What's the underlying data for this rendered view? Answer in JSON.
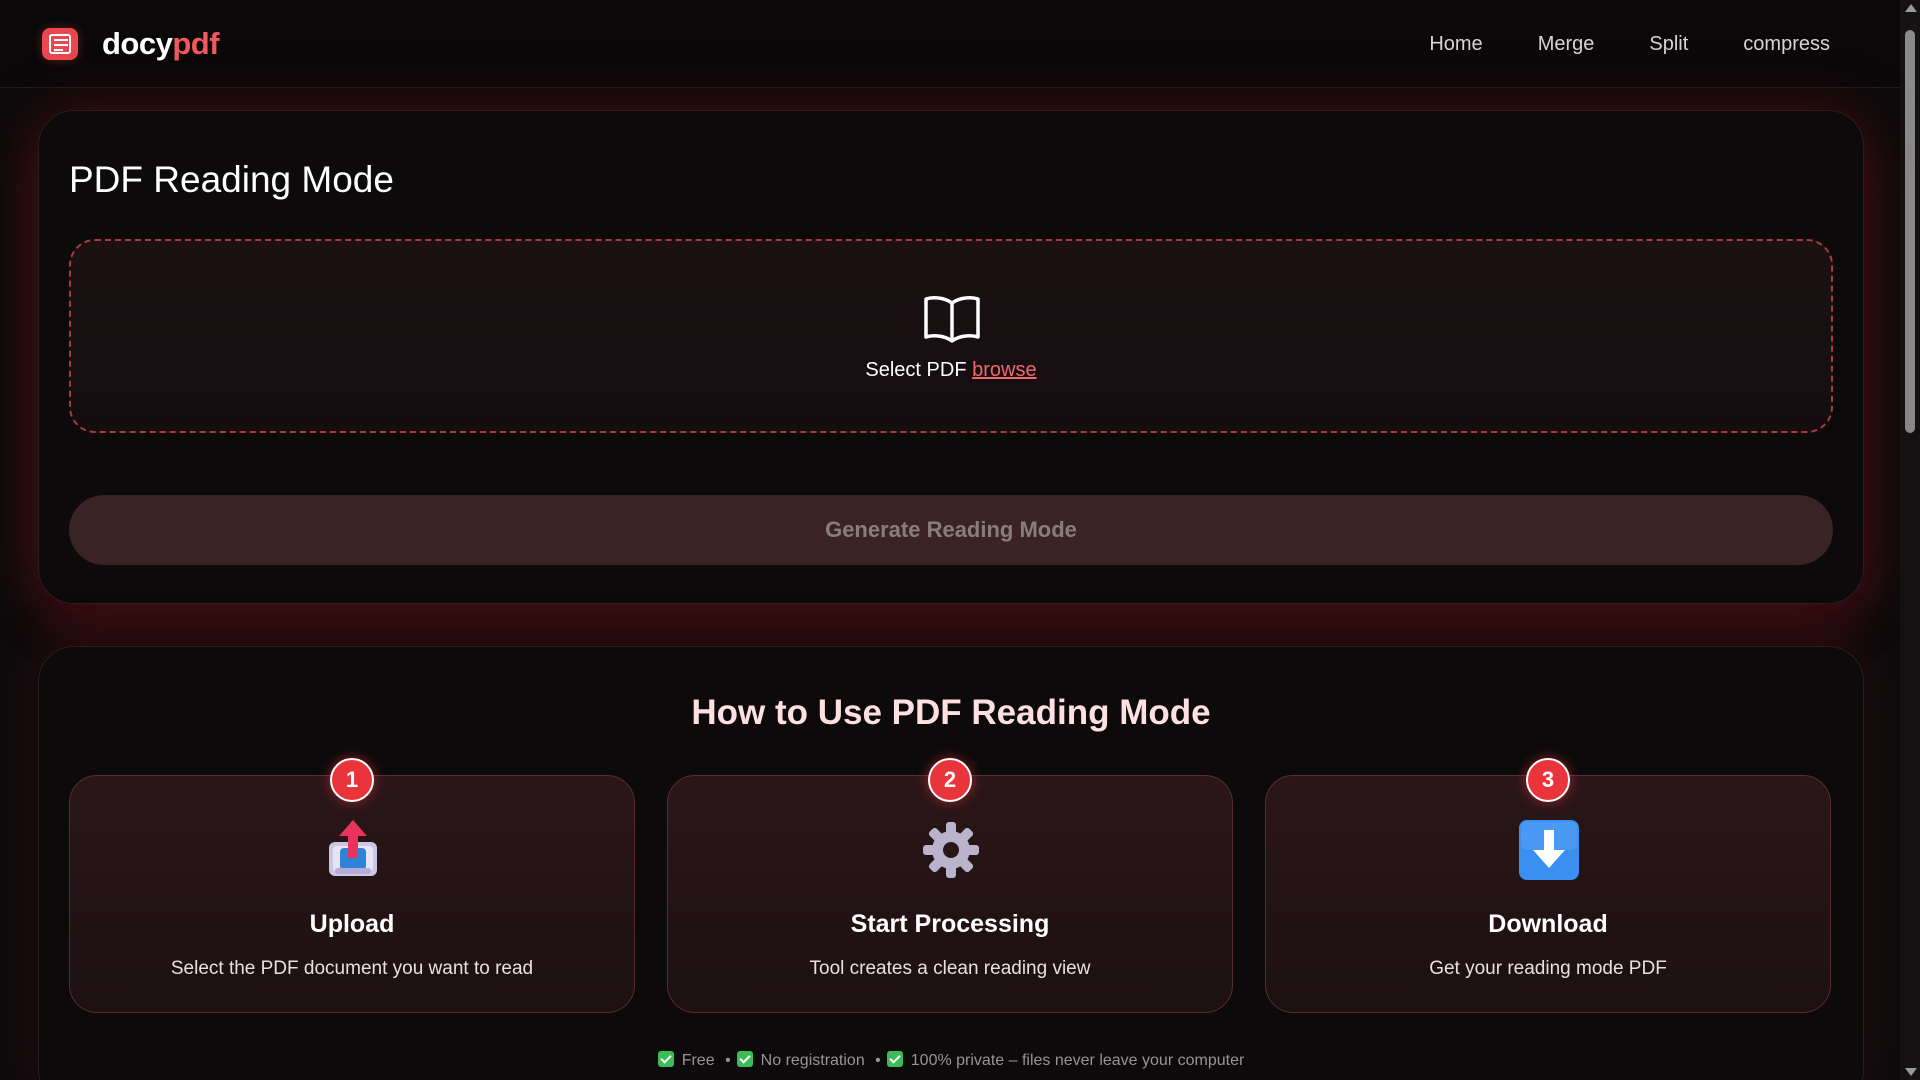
{
  "brand": {
    "part1": "docy",
    "part2": "pdf",
    "accent_color": "#f05a5f",
    "icon": "pdf-logo-icon"
  },
  "nav": {
    "items": [
      "Home",
      "Merge",
      "Split",
      "compress"
    ]
  },
  "reader": {
    "title": "PDF Reading Mode",
    "dropzone_icon": "open-book-icon",
    "select_text": "Select PDF",
    "browse_text": "browse",
    "generate_button": "Generate Reading Mode",
    "generate_enabled": false
  },
  "how_to": {
    "title": "How to Use PDF Reading Mode",
    "steps": [
      {
        "number": "1",
        "icon": "upload-tray-icon",
        "title": "Upload",
        "desc": "Select the PDF document you want to read"
      },
      {
        "number": "2",
        "icon": "gear-icon",
        "title": "Start Processing",
        "desc": "Tool creates a clean reading view"
      },
      {
        "number": "3",
        "icon": "download-arrow-icon",
        "title": "Download",
        "desc": "Get your reading mode PDF"
      }
    ],
    "features": [
      "Free",
      "No registration",
      "100% private – files never leave your computer"
    ],
    "feature_separator": "•"
  }
}
